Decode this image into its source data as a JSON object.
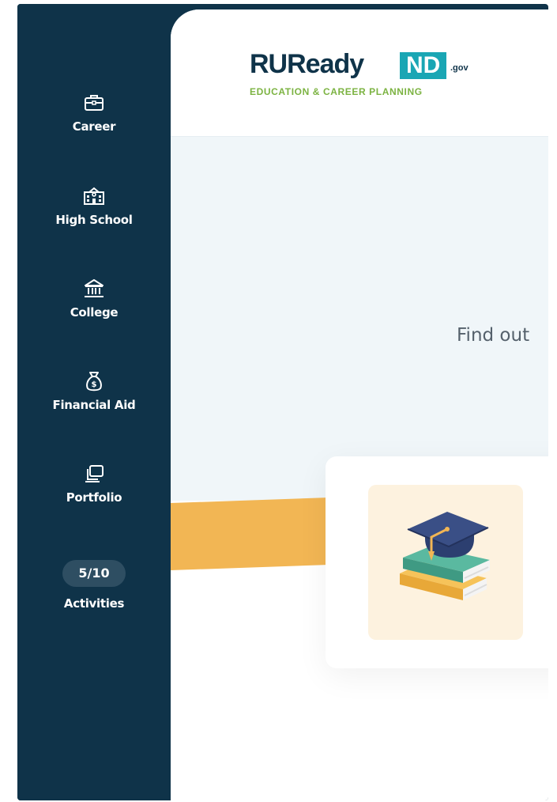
{
  "brand": {
    "name_part1": "RUReady",
    "name_part2": "ND",
    "suffix": ".gov",
    "tagline": "EDUCATION & CAREER PLANNING"
  },
  "sidebar": {
    "items": [
      {
        "label": "Career",
        "icon": "briefcase-icon"
      },
      {
        "label": "High School",
        "icon": "school-building-icon"
      },
      {
        "label": "College",
        "icon": "institution-icon"
      },
      {
        "label": "Financial Aid",
        "icon": "money-bag-icon"
      },
      {
        "label": "Portfolio",
        "icon": "portfolio-icon"
      }
    ],
    "activities": {
      "count": "5/10",
      "label": "Activities"
    }
  },
  "hero": {
    "text": "Find out"
  },
  "card": {
    "image_icon": "graduation-cap-books-icon"
  },
  "colors": {
    "sidebar_bg": "#0f3349",
    "accent_teal": "#1aa6b4",
    "accent_orange": "#f2b654",
    "tagline_green": "#7cb342"
  }
}
